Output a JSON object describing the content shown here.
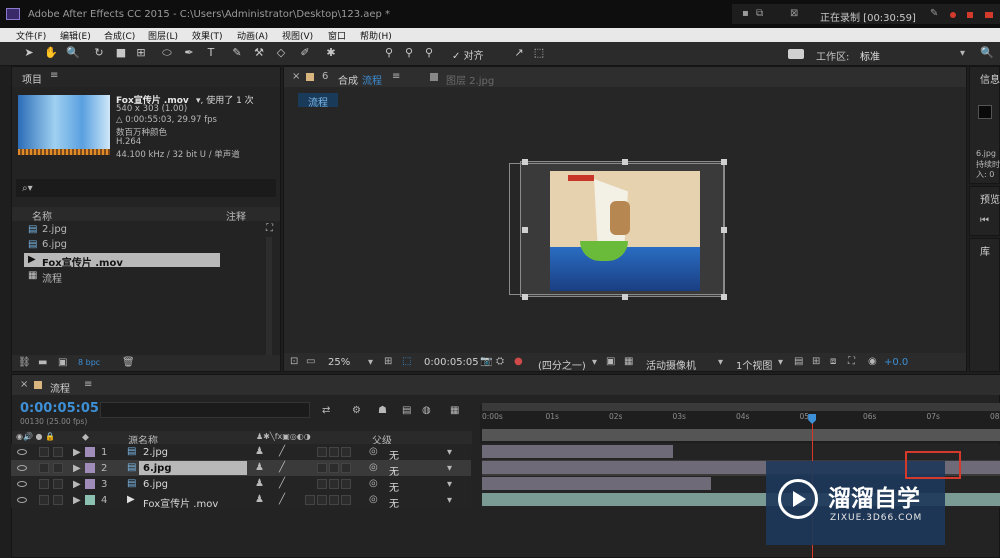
{
  "app": {
    "title": "Adobe After Effects CC 2015 - C:\\Users\\Administrator\\Desktop\\123.aep *",
    "recording": "正在录制 [00:30:59]"
  },
  "menu": [
    "文件(F)",
    "编辑(E)",
    "合成(C)",
    "图层(L)",
    "效果(T)",
    "动画(A)",
    "视图(V)",
    "窗口",
    "帮助(H)"
  ],
  "toolbar": {
    "align_label": "对齐",
    "workspace_label": "工作区:",
    "workspace_value": "标准"
  },
  "project": {
    "tab": "项目",
    "file_name": "Fox宣传片 .mov",
    "used": "▾, 使用了 1 次",
    "dims": "540 x 303 (1.00)",
    "duration": "△ 0:00:55:03, 29.97 fps",
    "colors": "数百万种颜色",
    "codec": "H.264",
    "audio": "44.100 kHz / 32 bit U / 单声道",
    "col_name": "名称",
    "col_note": "注释",
    "items": [
      "2.jpg",
      "6.jpg",
      "Fox宣传片 .mov",
      "流程"
    ],
    "bpc": "8 bpc"
  },
  "comp": {
    "tab_title": "合成",
    "comp_name": "流程",
    "footage_tab": "图层 2.jpg",
    "breadcrumb": "流程",
    "zoom": "25%",
    "timecode": "0:00:05:05",
    "resolution": "(四分之一)",
    "camera": "活动摄像机",
    "views": "1个视图",
    "exposure": "+0.0"
  },
  "right_panel": {
    "info": "信息",
    "info_text1": "6.jpg",
    "info_text2": "持续时",
    "info_text3": "入: 0",
    "preview": "预览",
    "library": "库"
  },
  "timeline": {
    "tab": "流程",
    "timecode": "0:00:05:05",
    "frame": "00130 (25.00 fps)",
    "col_source": "源名称",
    "col_parent": "父级",
    "layers": [
      {
        "num": "1",
        "name": "2.jpg",
        "parent": "无"
      },
      {
        "num": "2",
        "name": "6.jpg",
        "parent": "无"
      },
      {
        "num": "3",
        "name": "6.jpg",
        "parent": "无"
      },
      {
        "num": "4",
        "name": "Fox宣传片 .mov",
        "parent": "无"
      }
    ],
    "ticks": [
      "0:00s",
      "01s",
      "02s",
      "03s",
      "04s",
      "05s",
      "06s",
      "07s",
      "08s"
    ]
  },
  "layer_bars": [
    {
      "start": 0,
      "end": 3.0
    },
    {
      "start": 0,
      "end": 8.2
    },
    {
      "start": 0,
      "end": 3.6
    },
    {
      "start": 0,
      "end": 8.2
    }
  ],
  "playhead_seconds": 5.2,
  "watermark": {
    "title": "溜溜自学",
    "url": "ZIXUE.3D66.COM"
  },
  "colors": {
    "accent": "#3d8fd6",
    "timecode": "#3d8fd6",
    "playhead": "#d43a2c"
  }
}
